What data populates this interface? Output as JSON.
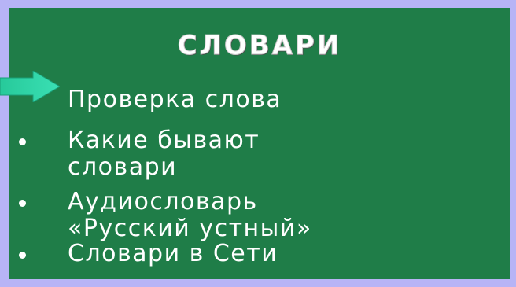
{
  "panel": {
    "title": "СЛОВАРИ"
  },
  "menu": {
    "items": [
      {
        "label": "Проверка слова"
      },
      {
        "label": "Какие бывают",
        "label2": "словари"
      },
      {
        "label": "Аудиословарь",
        "label2": "«Русский устный»"
      },
      {
        "label": "Словари в Сети"
      }
    ]
  },
  "colors": {
    "background": "#b7b4f6",
    "panel": "#1f7d48",
    "arrow": "#2fd6a8",
    "text": "#ffffff"
  },
  "icons": {
    "pointer": "arrow-right-icon",
    "bullet": "bullet-icon"
  }
}
